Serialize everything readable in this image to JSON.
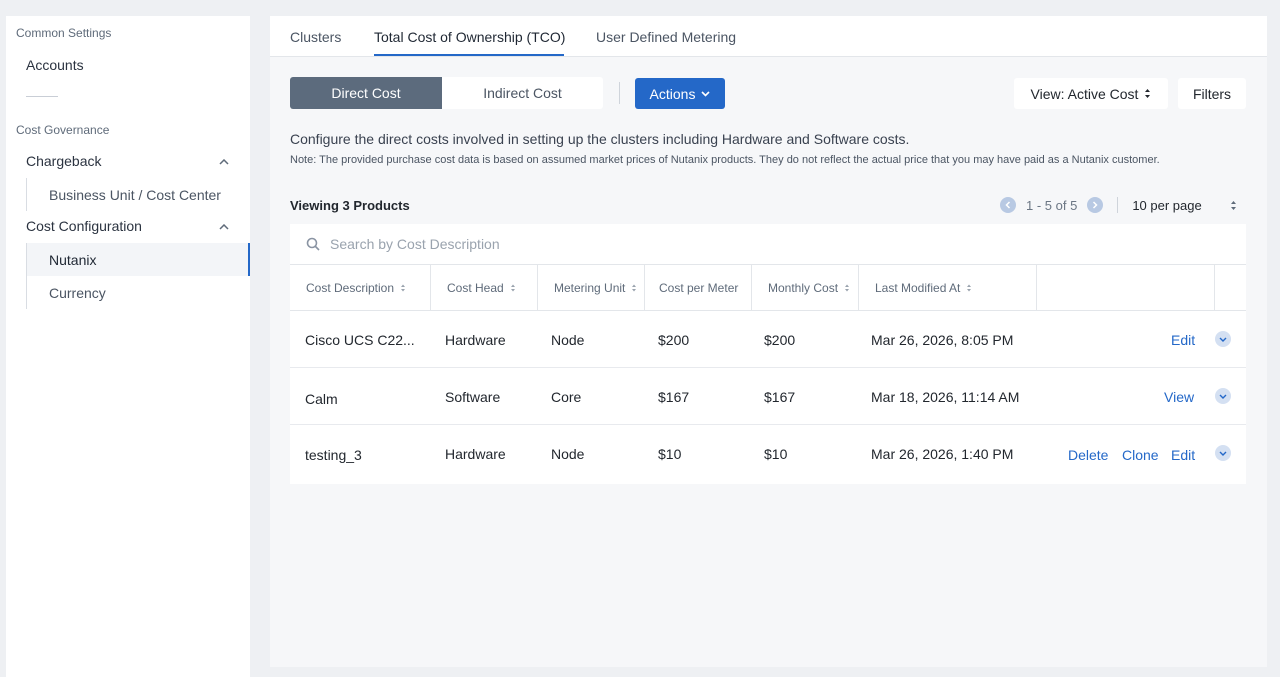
{
  "sidebar": {
    "section_common": "Common Settings",
    "accounts": "Accounts",
    "section_cost": "Cost Governance",
    "chargeback": "Chargeback",
    "business_unit": "Business Unit / Cost Center",
    "cost_configuration": "Cost Configuration",
    "nutanix": "Nutanix",
    "currency": "Currency"
  },
  "tabs": [
    {
      "label": "Clusters"
    },
    {
      "label": "Total Cost of Ownership (TCO)"
    },
    {
      "label": "User Defined Metering"
    }
  ],
  "toolbar": {
    "direct_cost": "Direct Cost",
    "indirect_cost": "Indirect Cost",
    "actions": "Actions",
    "view": "View: Active Cost",
    "filters": "Filters"
  },
  "description": "Configure the direct costs involved in setting up the clusters including Hardware and Software costs.",
  "note": "Note: The provided purchase cost data is based on assumed market prices of Nutanix products. They do not reflect the actual price that you may have paid as a Nutanix customer.",
  "viewing": "Viewing 3 Products",
  "pagination": {
    "range": "1 - 5 of 5",
    "per_page": "10 per page"
  },
  "search": {
    "placeholder": "Search by Cost Description"
  },
  "table": {
    "headers": [
      "Cost Description",
      "Cost Head",
      "Metering Unit",
      "Cost per Meter",
      "Monthly Cost",
      "Last Modified At"
    ],
    "rows": [
      {
        "description": "Cisco UCS C22...",
        "head": "Hardware",
        "unit": "Node",
        "per_meter": "$200",
        "monthly": "$200",
        "modified": "Mar 26, 2026, 8:05 PM",
        "actions": [
          "Edit"
        ]
      },
      {
        "description": "Calm",
        "head": "Software",
        "unit": "Core",
        "per_meter": "$167",
        "monthly": "$167",
        "modified": "Mar 18, 2026, 11:14 AM",
        "actions": [
          "View"
        ]
      },
      {
        "description": "testing_3",
        "head": "Hardware",
        "unit": "Node",
        "per_meter": "$10",
        "monthly": "$10",
        "modified": "Mar 26, 2026, 1:40 PM",
        "actions": [
          "Delete",
          "Clone",
          "Edit"
        ]
      }
    ]
  }
}
